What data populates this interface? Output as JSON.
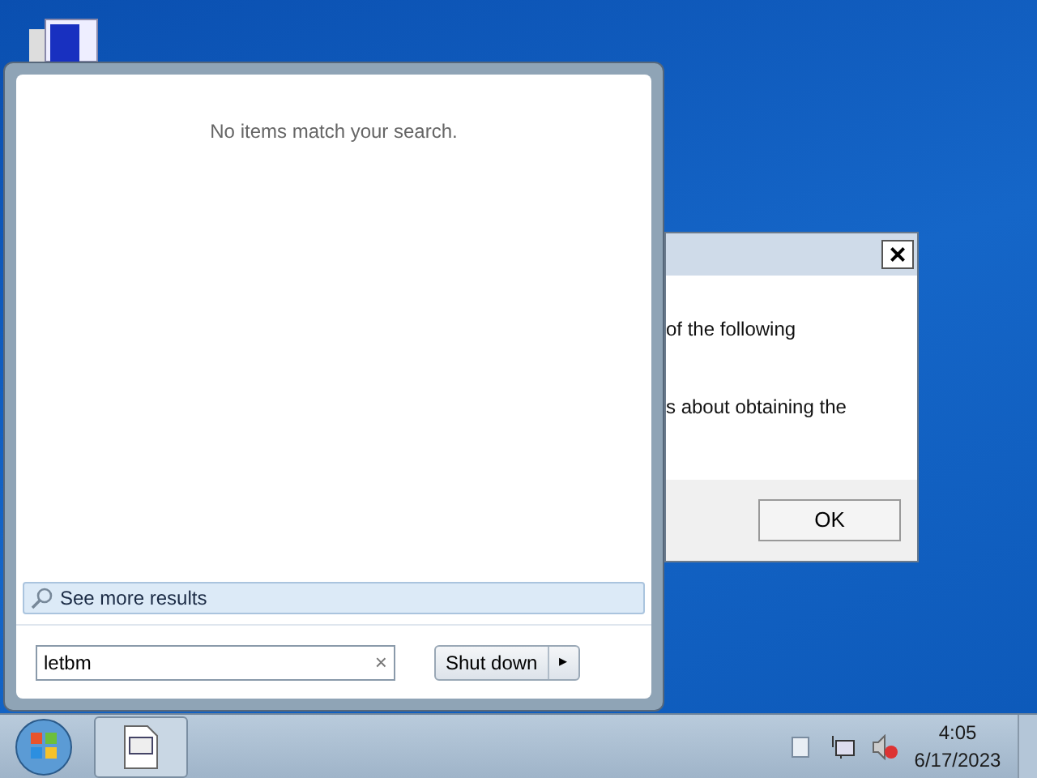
{
  "start_menu": {
    "message": "No items match your search.",
    "see_more": "See more results",
    "search": {
      "value": "letbm",
      "clear": "×"
    },
    "shutdown": {
      "label": "Shut down",
      "arrow": "▸"
    }
  },
  "dialog": {
    "close": "×",
    "lines": [
      "of the following",
      "s about obtaining the"
    ],
    "ok": "OK"
  },
  "taskbar": {
    "time": "4:05",
    "date": "6/17/2023"
  }
}
